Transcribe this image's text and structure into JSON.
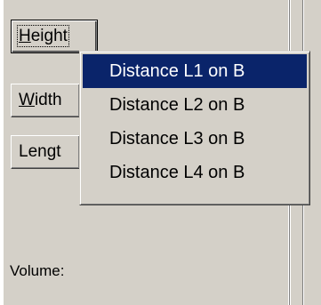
{
  "buttons": {
    "height": {
      "prefix": "",
      "underlined": "H",
      "rest": "eight"
    },
    "width": {
      "prefix": "",
      "underlined": "W",
      "rest": "idth"
    },
    "length": {
      "label": "Lengt"
    }
  },
  "volume_label": "Volume:",
  "menu": {
    "items": [
      {
        "label": "Distance L1 on B",
        "selected": true
      },
      {
        "label": "Distance L2 on B",
        "selected": false
      },
      {
        "label": "Distance L3 on B",
        "selected": false
      },
      {
        "label": "Distance L4 on B",
        "selected": false
      }
    ],
    "highlight_color": "#0a246a"
  },
  "colors": {
    "face": "#d4d0c8",
    "shadow": "#808080",
    "highlight": "#ffffff"
  }
}
